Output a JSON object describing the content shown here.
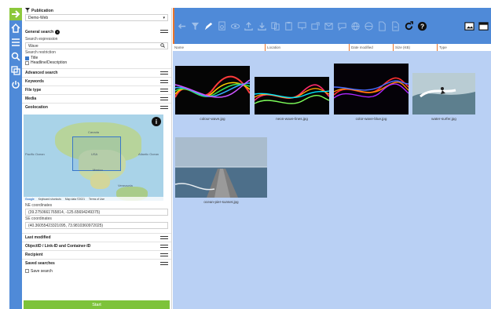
{
  "sidebar_nav": {
    "items": [
      {
        "icon": "arrow-right-icon",
        "active": true
      },
      {
        "icon": "home-icon"
      },
      {
        "icon": "menu-icon"
      },
      {
        "icon": "search-icon"
      },
      {
        "icon": "copy-icon"
      },
      {
        "icon": "power-icon"
      }
    ]
  },
  "panel": {
    "publication_label": "Publication",
    "publication_value": "Demo-Web",
    "general_search": "General search",
    "search_expression_label": "Search expression",
    "search_expression_value": "Wave",
    "search_restriction_label": "Search restriction",
    "restriction_options": [
      {
        "label": "Title",
        "checked": true
      },
      {
        "label": "Headline/Description",
        "checked": false
      }
    ],
    "sections_top": [
      "Advanced search",
      "Keywords",
      "File type",
      "Media",
      "Geolocation"
    ],
    "map": {
      "labels": {
        "north_america": "Canada",
        "usa": "USA",
        "mexico": "Mexico",
        "ocean_left": "Pacific Ocean",
        "ocean_right": "Atlantic Ocean",
        "south_america": "Venezuela"
      },
      "attribution": [
        "Google",
        "Keyboard shortcuts",
        "Map data ©2021",
        "Terms of Use"
      ]
    },
    "ne_label": "NE coordinates",
    "ne_value": "(39.2750661765814, -125.65694249375)",
    "se_label": "SE coordinates",
    "se_value": "(40.36055423321095, 73.9810360972025)",
    "sections_bottom": [
      "Last modified",
      "ObjectID / Link-ID and Container-ID",
      "Recipient",
      "Saved searches"
    ],
    "save_search_label": "Save search",
    "start_label": "Start"
  },
  "results": {
    "columns": [
      "Name",
      "Location",
      "Date modified",
      "Size (KB)",
      "Type"
    ],
    "items": [
      {
        "name": "colour-wave.jpg",
        "kind": "wave1"
      },
      {
        "name": "neon-wave-lines.jpg",
        "kind": "wave2"
      },
      {
        "name": "color-wave-blue.jpg",
        "kind": "wave3"
      },
      {
        "name": "water-surfer.jpg",
        "kind": "surf"
      },
      {
        "name": "ocean-pier-sunset.jpg",
        "kind": "pier"
      }
    ]
  },
  "colors": {
    "rail": "#4f8ad8",
    "accent_green": "#7dc33a",
    "accent_orange": "#e9742b",
    "content_bg": "#b9d0f4"
  }
}
